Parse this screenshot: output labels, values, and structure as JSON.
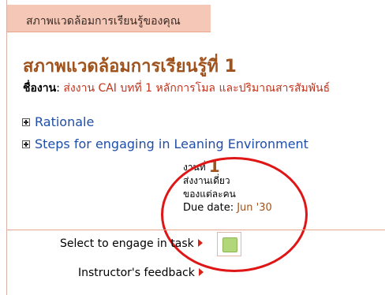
{
  "tab": {
    "label": "สภาพแวดล้อมการเรียนรู้ของคุณ"
  },
  "page": {
    "title": "สภาพแวดล้อมการเรียนรู้ที่ 1"
  },
  "task": {
    "label": "ชื่องาน",
    "separator": ": ",
    "value": "ส่งงาน CAI บทที่ 1 หลักการโมล และปริมาณสารสัมพันธ์"
  },
  "sections": {
    "rationale": "Rationale",
    "steps": "Steps for engaging in Leaning Environment"
  },
  "task_info": {
    "label": "งานที่",
    "number": "1",
    "type": "ส่งงานเดี่ยว",
    "ownership": "ของแต่ละคน",
    "due_label": "Due date:",
    "due_value": "Jun '30"
  },
  "actions": {
    "select_label": "Select to engage in task",
    "feedback_label": "Instructor's feedback"
  },
  "colors": {
    "tab_bg": "#f4c7b6",
    "title": "#a0521c",
    "link": "#1f4ea8",
    "task_value": "#c0331b",
    "annotation": "#e01616",
    "select_square": "#b2d67a"
  }
}
